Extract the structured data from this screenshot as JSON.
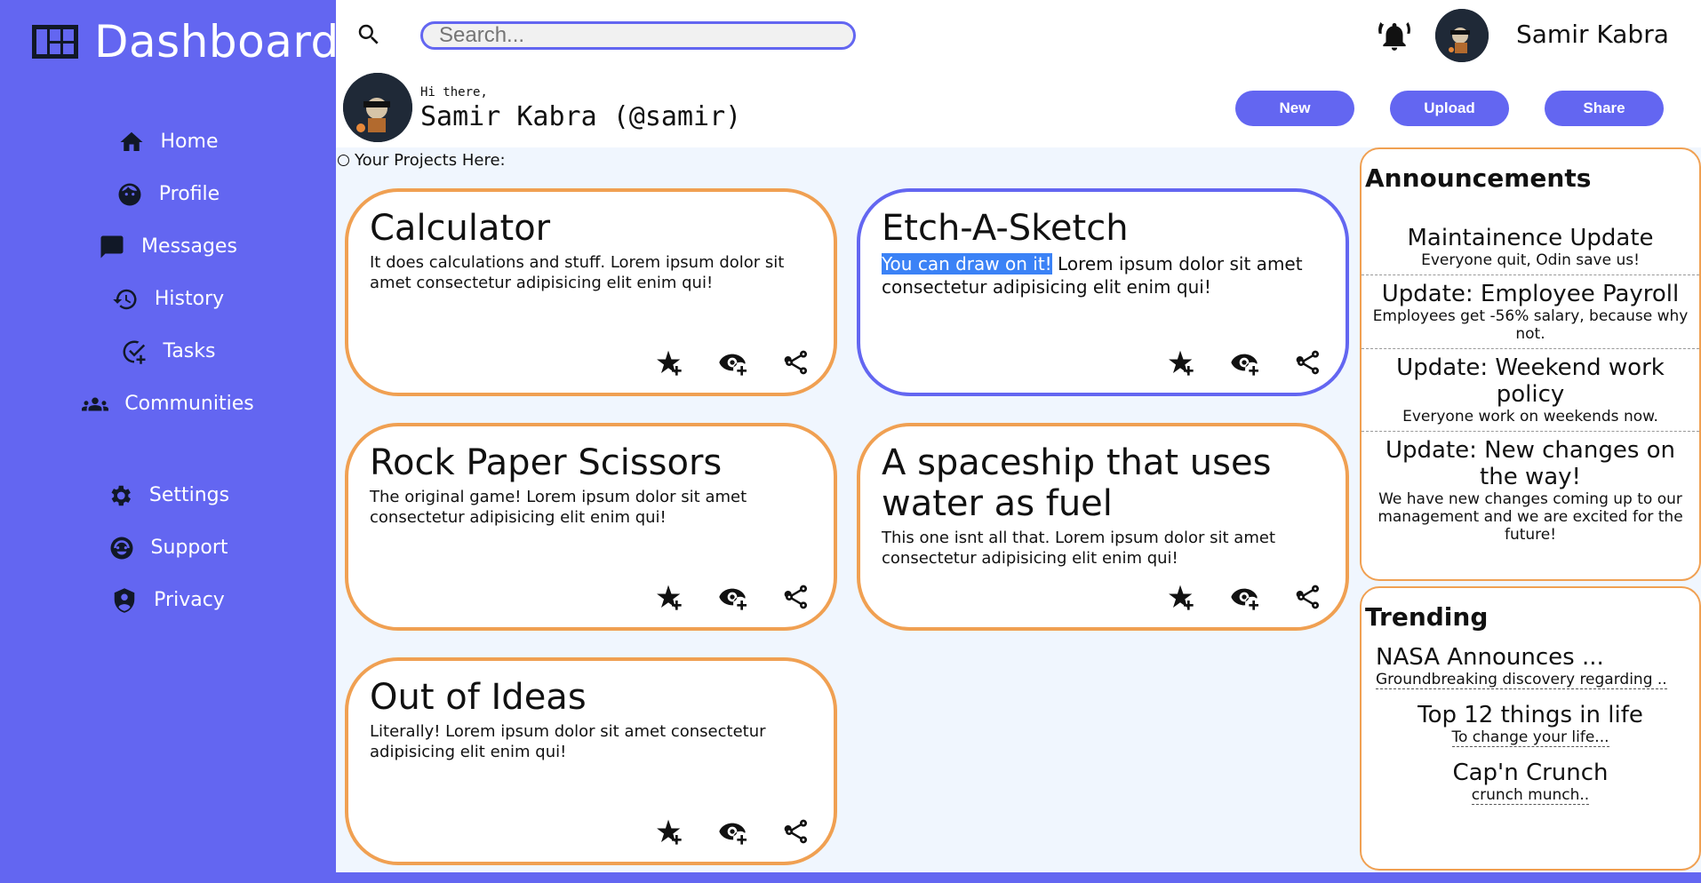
{
  "sidebar": {
    "title": "Dashboard",
    "items": [
      {
        "label": "Home",
        "icon": "home-icon"
      },
      {
        "label": "Profile",
        "icon": "face-icon"
      },
      {
        "label": "Messages",
        "icon": "chat-icon"
      },
      {
        "label": "History",
        "icon": "history-icon"
      },
      {
        "label": "Tasks",
        "icon": "task-check-icon"
      },
      {
        "label": "Communities",
        "icon": "group-icon"
      }
    ],
    "items2": [
      {
        "label": "Settings",
        "icon": "gear-icon"
      },
      {
        "label": "Support",
        "icon": "support-icon"
      },
      {
        "label": "Privacy",
        "icon": "shield-icon"
      }
    ]
  },
  "topbar": {
    "search_placeholder": "Search...",
    "username": "Samir Kabra"
  },
  "greeting": {
    "small": "Hi there,",
    "name": "Samir Kabra (@samir)",
    "buttons": [
      "New",
      "Upload",
      "Share"
    ]
  },
  "main": {
    "projects_label": "Your Projects Here:",
    "projects": [
      {
        "title": "Calculator",
        "highlight": "",
        "desc": "It does calculations and stuff. Lorem ipsum dolor sit amet consectetur adipisicing elit enim qui!"
      },
      {
        "title": "Etch-A-Sketch",
        "highlight": "You can draw on it!",
        "desc": " Lorem ipsum dolor sit amet consectetur adipisicing elit enim qui!"
      },
      {
        "title": "Rock Paper Scissors",
        "highlight": "",
        "desc": "The original game! Lorem ipsum dolor sit amet consectetur adipisicing elit enim qui!"
      },
      {
        "title": "A spaceship that uses water as fuel",
        "highlight": "",
        "desc": "This one isnt all that. Lorem ipsum dolor sit amet consectetur adipisicing elit enim qui!"
      },
      {
        "title": "Out of Ideas",
        "highlight": "",
        "desc": "Literally! Lorem ipsum dolor sit amet consectetur adipisicing elit enim qui!"
      }
    ]
  },
  "announcements": {
    "title": "Announcements",
    "items": [
      {
        "title": "Maintainence Update",
        "text": "Everyone quit, Odin save us!"
      },
      {
        "title": "Update: Employee Payroll",
        "text": "Employees get -56% salary, because why not."
      },
      {
        "title": "Update: Weekend work policy",
        "text": "Everyone work on weekends now."
      },
      {
        "title": "Update: New changes on the way!",
        "text": "We have new changes coming up to our management and we are excited for the future!"
      }
    ]
  },
  "trending": {
    "title": "Trending",
    "items": [
      {
        "title": "NASA Announces ...",
        "sub": "Groundbreaking discovery regarding .."
      },
      {
        "title": "Top 12 things in life",
        "sub": "To change your life..."
      },
      {
        "title": "Cap'n Crunch",
        "sub": "crunch munch.."
      }
    ]
  },
  "colors": {
    "accent": "#6366f1",
    "card_border": "#f0a052",
    "main_bg": "#f0f6fe",
    "highlight": "#3b82f6"
  }
}
